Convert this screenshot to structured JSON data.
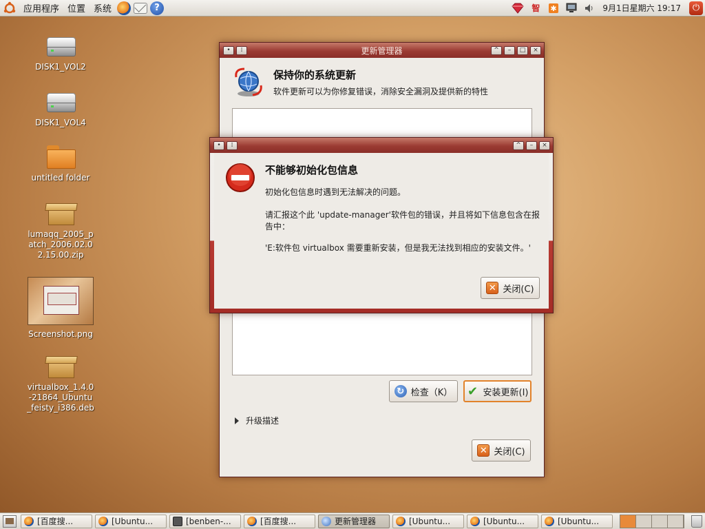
{
  "top_panel": {
    "menus": [
      "应用程序",
      "位置",
      "系统"
    ],
    "clock": "9月1日星期六 19:17",
    "tray_text": "智"
  },
  "desktop": {
    "icons": [
      {
        "label": "DISK1_VOL2",
        "icon": "drive-icon"
      },
      {
        "label": "DISK1_VOL4",
        "icon": "drive-icon"
      },
      {
        "label": "untitled folder",
        "icon": "folder-icon"
      },
      {
        "label": "lumaqq_2005_patch_2006.02.02.15.00.zip",
        "icon": "archive-icon"
      },
      {
        "label": "Screenshot.png",
        "icon": "image-thumbnail-icon"
      },
      {
        "label": "virtualbox_1.4.0-21864_Ubuntu_feisty_i386.deb",
        "icon": "package-icon"
      }
    ]
  },
  "update_manager": {
    "window_title": "更新管理器",
    "heading": "保持你的系统更新",
    "subtitle": "软件更新可以为你修复错误，消除安全漏洞及提供新的特性",
    "check_button": "检查（K）",
    "install_button": "安装更新(I)",
    "description_toggle": "升级描述",
    "close_button": "关闭(C)"
  },
  "error_dialog": {
    "heading": "不能够初始化包信息",
    "message1": "初始化包信息时遇到无法解决的问题。",
    "message2": "请汇报这个此 'update-manager'软件包的错误，并且将如下信息包含在报告中：",
    "message3": "'E:软件包 virtualbox 需要重新安装，但是我无法找到相应的安装文件。'",
    "close_button": "关闭(C)"
  },
  "taskbar": {
    "tasks": [
      {
        "label": "[百度搜...",
        "icon": "firefox"
      },
      {
        "label": "[Ubuntu...",
        "icon": "firefox"
      },
      {
        "label": "[benben-...",
        "icon": "terminal"
      },
      {
        "label": "[百度搜...",
        "icon": "firefox"
      },
      {
        "label": "更新管理器",
        "icon": "update",
        "active": true
      },
      {
        "label": "[Ubuntu...",
        "icon": "firefox"
      },
      {
        "label": "[Ubuntu...",
        "icon": "firefox"
      },
      {
        "label": "[Ubuntu...",
        "icon": "firefox"
      }
    ]
  },
  "colors": {
    "titlebar": "#9b3b33",
    "accent": "#e2822a",
    "error_red": "#d42a1c"
  }
}
